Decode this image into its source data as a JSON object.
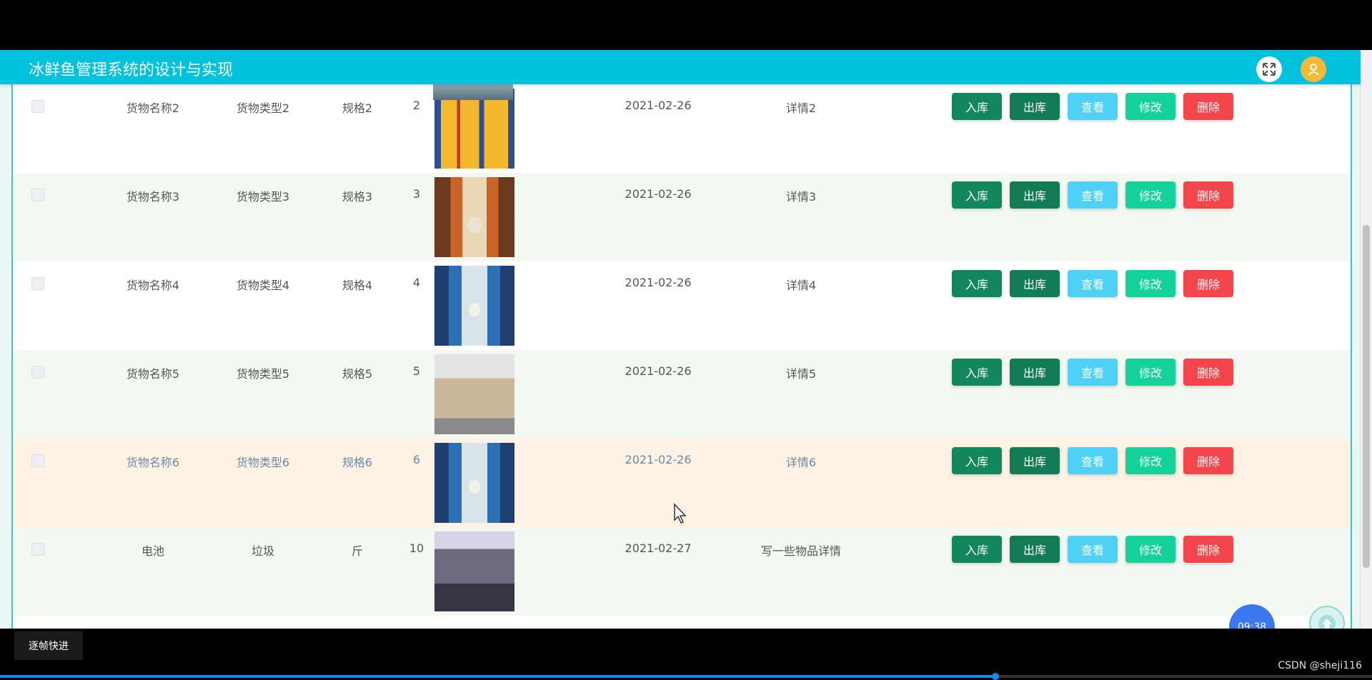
{
  "header": {
    "title": "冰鲜鱼管理系统的设计与实现"
  },
  "table": {
    "actions": {
      "in": "入库",
      "out": "出库",
      "view": "查看",
      "edit": "修改",
      "del": "删除"
    },
    "rows": [
      {
        "name": "货物名称2",
        "type": "货物类型2",
        "spec": "规格2",
        "qty": "2",
        "date": "2021-02-26",
        "detail": "详情2",
        "image": "warehouse-shelves-yellow"
      },
      {
        "name": "货物名称3",
        "type": "货物类型3",
        "spec": "规格3",
        "qty": "3",
        "date": "2021-02-26",
        "detail": "详情3",
        "image": "warehouse-aisle-orange"
      },
      {
        "name": "货物名称4",
        "type": "货物类型4",
        "spec": "规格4",
        "qty": "4",
        "date": "2021-02-26",
        "detail": "详情4",
        "image": "warehouse-aisle-blue"
      },
      {
        "name": "货物名称5",
        "type": "货物类型5",
        "spec": "规格5",
        "qty": "5",
        "date": "2021-02-26",
        "detail": "详情5",
        "image": "warehouse-boxes"
      },
      {
        "name": "货物名称6",
        "type": "货物类型6",
        "spec": "规格6",
        "qty": "6",
        "date": "2021-02-26",
        "detail": "详情6",
        "image": "warehouse-aisle-blue"
      },
      {
        "name": "电池",
        "type": "垃圾",
        "spec": "斤",
        "qty": "10",
        "date": "2021-02-27",
        "detail": "写一些物品详情",
        "image": "room-interior"
      }
    ]
  },
  "clock": {
    "text": "09:38"
  },
  "player": {
    "frame_step_label": "逐帧快进",
    "progress": 0.727
  },
  "watermark": "CSDN @sheji116",
  "colors": {
    "header": "#00c2dd",
    "btn_in": "#12875e",
    "btn_out": "#117c55",
    "btn_view": "#4fd1f5",
    "btn_edit": "#14d29a",
    "btn_del": "#f2464c"
  }
}
